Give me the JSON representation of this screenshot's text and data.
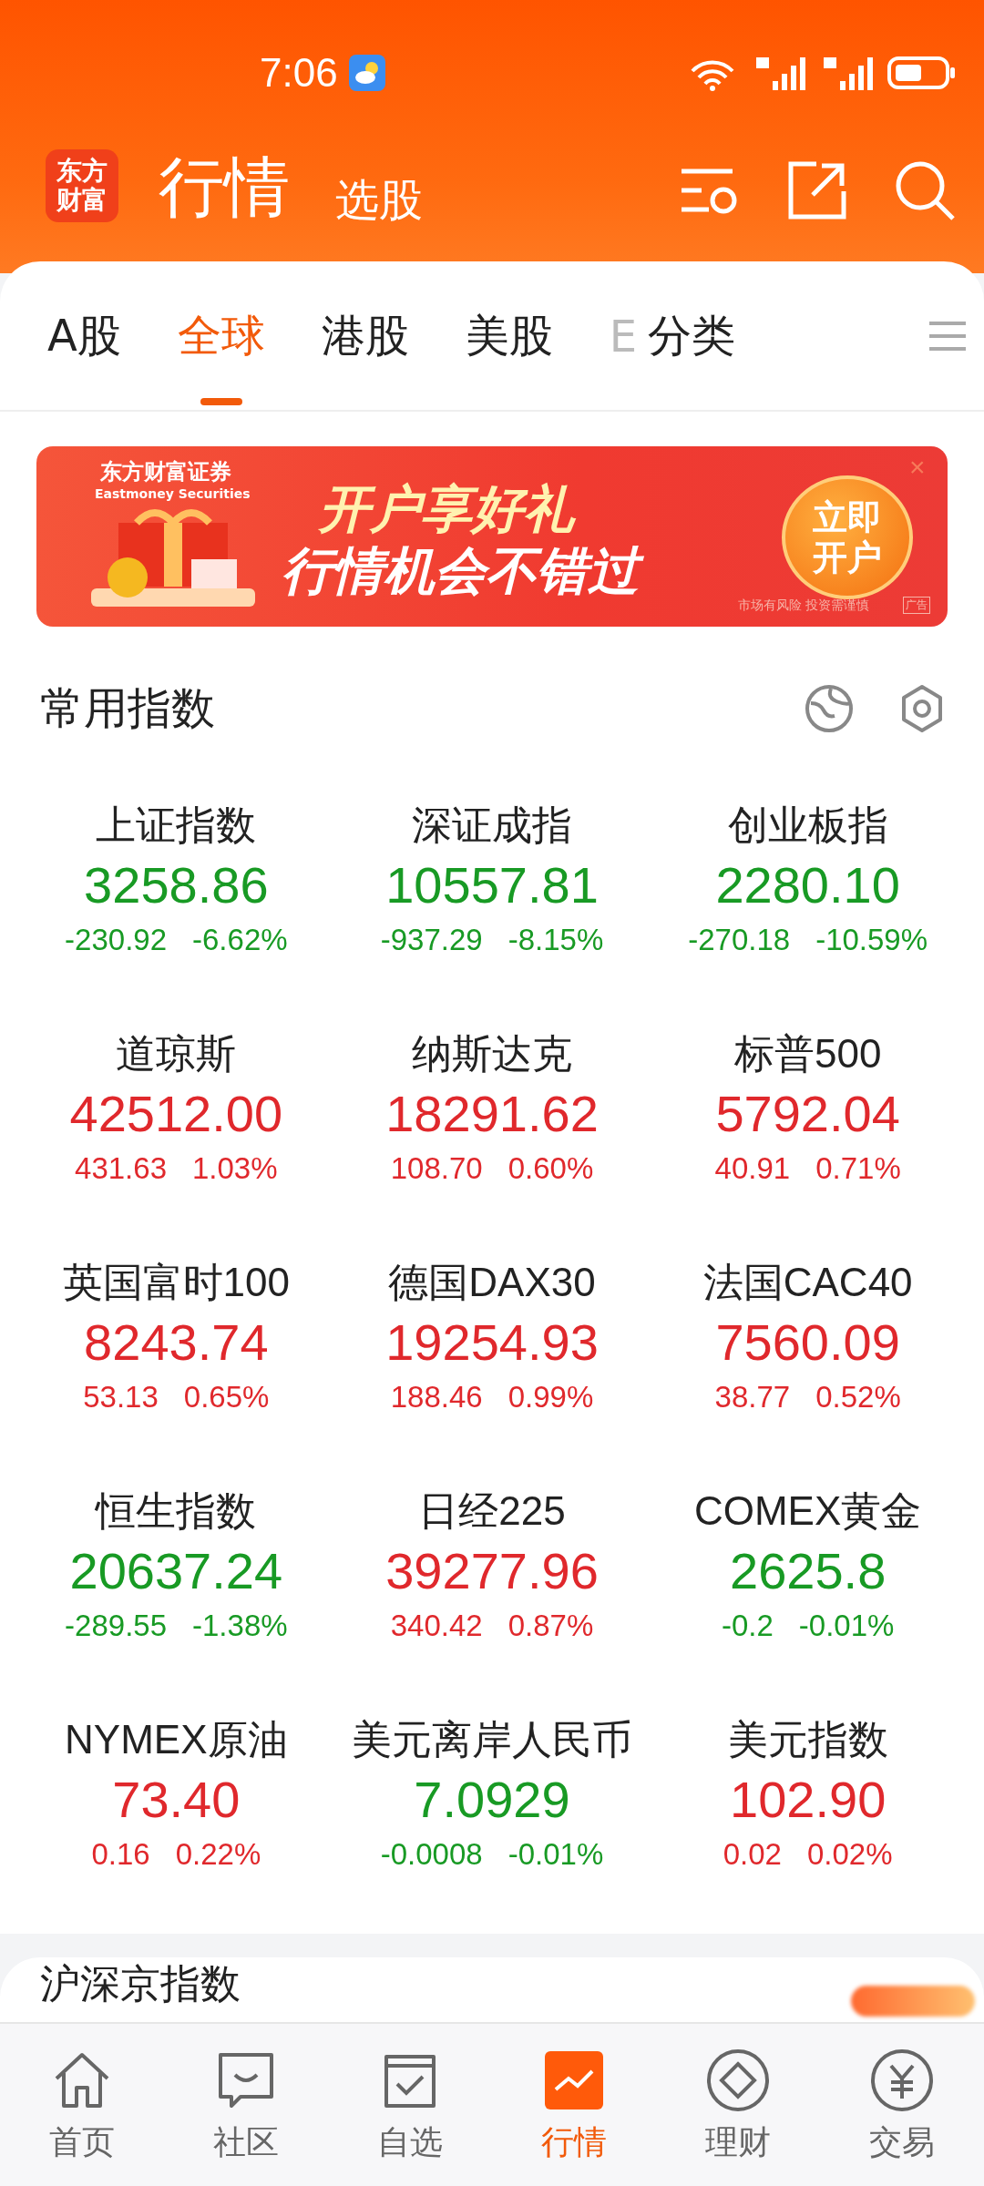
{
  "status_bar": {
    "time": "7:06"
  },
  "header": {
    "logo": "东方财富",
    "title": "行情",
    "subtitle": "选股"
  },
  "tabs": [
    {
      "label": "A股",
      "selected": false
    },
    {
      "label": "全球",
      "selected": true
    },
    {
      "label": "港股",
      "selected": false
    },
    {
      "label": "美股",
      "selected": false
    },
    {
      "label": "E",
      "selected": false
    },
    {
      "label": "分类",
      "selected": false
    }
  ],
  "banner": {
    "brand": "东方财富证券",
    "brand_en": "Eastmoney Securities",
    "headline": "开户享好礼",
    "subline": "行情机会不错过",
    "button": "立即开户",
    "disclaimer": "市场有风险 投资需谨慎",
    "ad_tag": "广告",
    "close": "×"
  },
  "indices_section": {
    "title": "常用指数",
    "items": [
      {
        "name": "上证指数",
        "value": "3258.86",
        "change": "-230.92",
        "percent": "-6.62%",
        "rising": false
      },
      {
        "name": "深证成指",
        "value": "10557.81",
        "change": "-937.29",
        "percent": "-8.15%",
        "rising": false
      },
      {
        "name": "创业板指",
        "value": "2280.10",
        "change": "-270.18",
        "percent": "-10.59%",
        "rising": false
      },
      {
        "name": "道琼斯",
        "value": "42512.00",
        "change": "431.63",
        "percent": "1.03%",
        "rising": true
      },
      {
        "name": "纳斯达克",
        "value": "18291.62",
        "change": "108.70",
        "percent": "0.60%",
        "rising": true
      },
      {
        "name": "标普500",
        "value": "5792.04",
        "change": "40.91",
        "percent": "0.71%",
        "rising": true
      },
      {
        "name": "英国富时100",
        "value": "8243.74",
        "change": "53.13",
        "percent": "0.65%",
        "rising": true
      },
      {
        "name": "德国DAX30",
        "value": "19254.93",
        "change": "188.46",
        "percent": "0.99%",
        "rising": true
      },
      {
        "name": "法国CAC40",
        "value": "7560.09",
        "change": "38.77",
        "percent": "0.52%",
        "rising": true
      },
      {
        "name": "恒生指数",
        "value": "20637.24",
        "change": "-289.55",
        "percent": "-1.38%",
        "rising": false
      },
      {
        "name": "日经225",
        "value": "39277.96",
        "change": "340.42",
        "percent": "0.87%",
        "rising": true
      },
      {
        "name": "COMEX黄金",
        "value": "2625.8",
        "change": "-0.2",
        "percent": "-0.01%",
        "rising": false
      },
      {
        "name": "NYMEX原油",
        "value": "73.40",
        "change": "0.16",
        "percent": "0.22%",
        "rising": true
      },
      {
        "name": "美元离岸人民币",
        "value": "7.0929",
        "change": "-0.0008",
        "percent": "-0.01%",
        "rising": false
      },
      {
        "name": "美元指数",
        "value": "102.90",
        "change": "0.02",
        "percent": "0.02%",
        "rising": true
      }
    ]
  },
  "next_section": {
    "title": "沪深京指数"
  },
  "bottom_nav": [
    {
      "label": "首页",
      "kind": "home",
      "selected": false
    },
    {
      "label": "社区",
      "kind": "chat",
      "selected": false
    },
    {
      "label": "自选",
      "kind": "check",
      "selected": false
    },
    {
      "label": "行情",
      "kind": "chart",
      "selected": true
    },
    {
      "label": "理财",
      "kind": "diamond",
      "selected": false
    },
    {
      "label": "交易",
      "kind": "yuan",
      "selected": false
    }
  ]
}
